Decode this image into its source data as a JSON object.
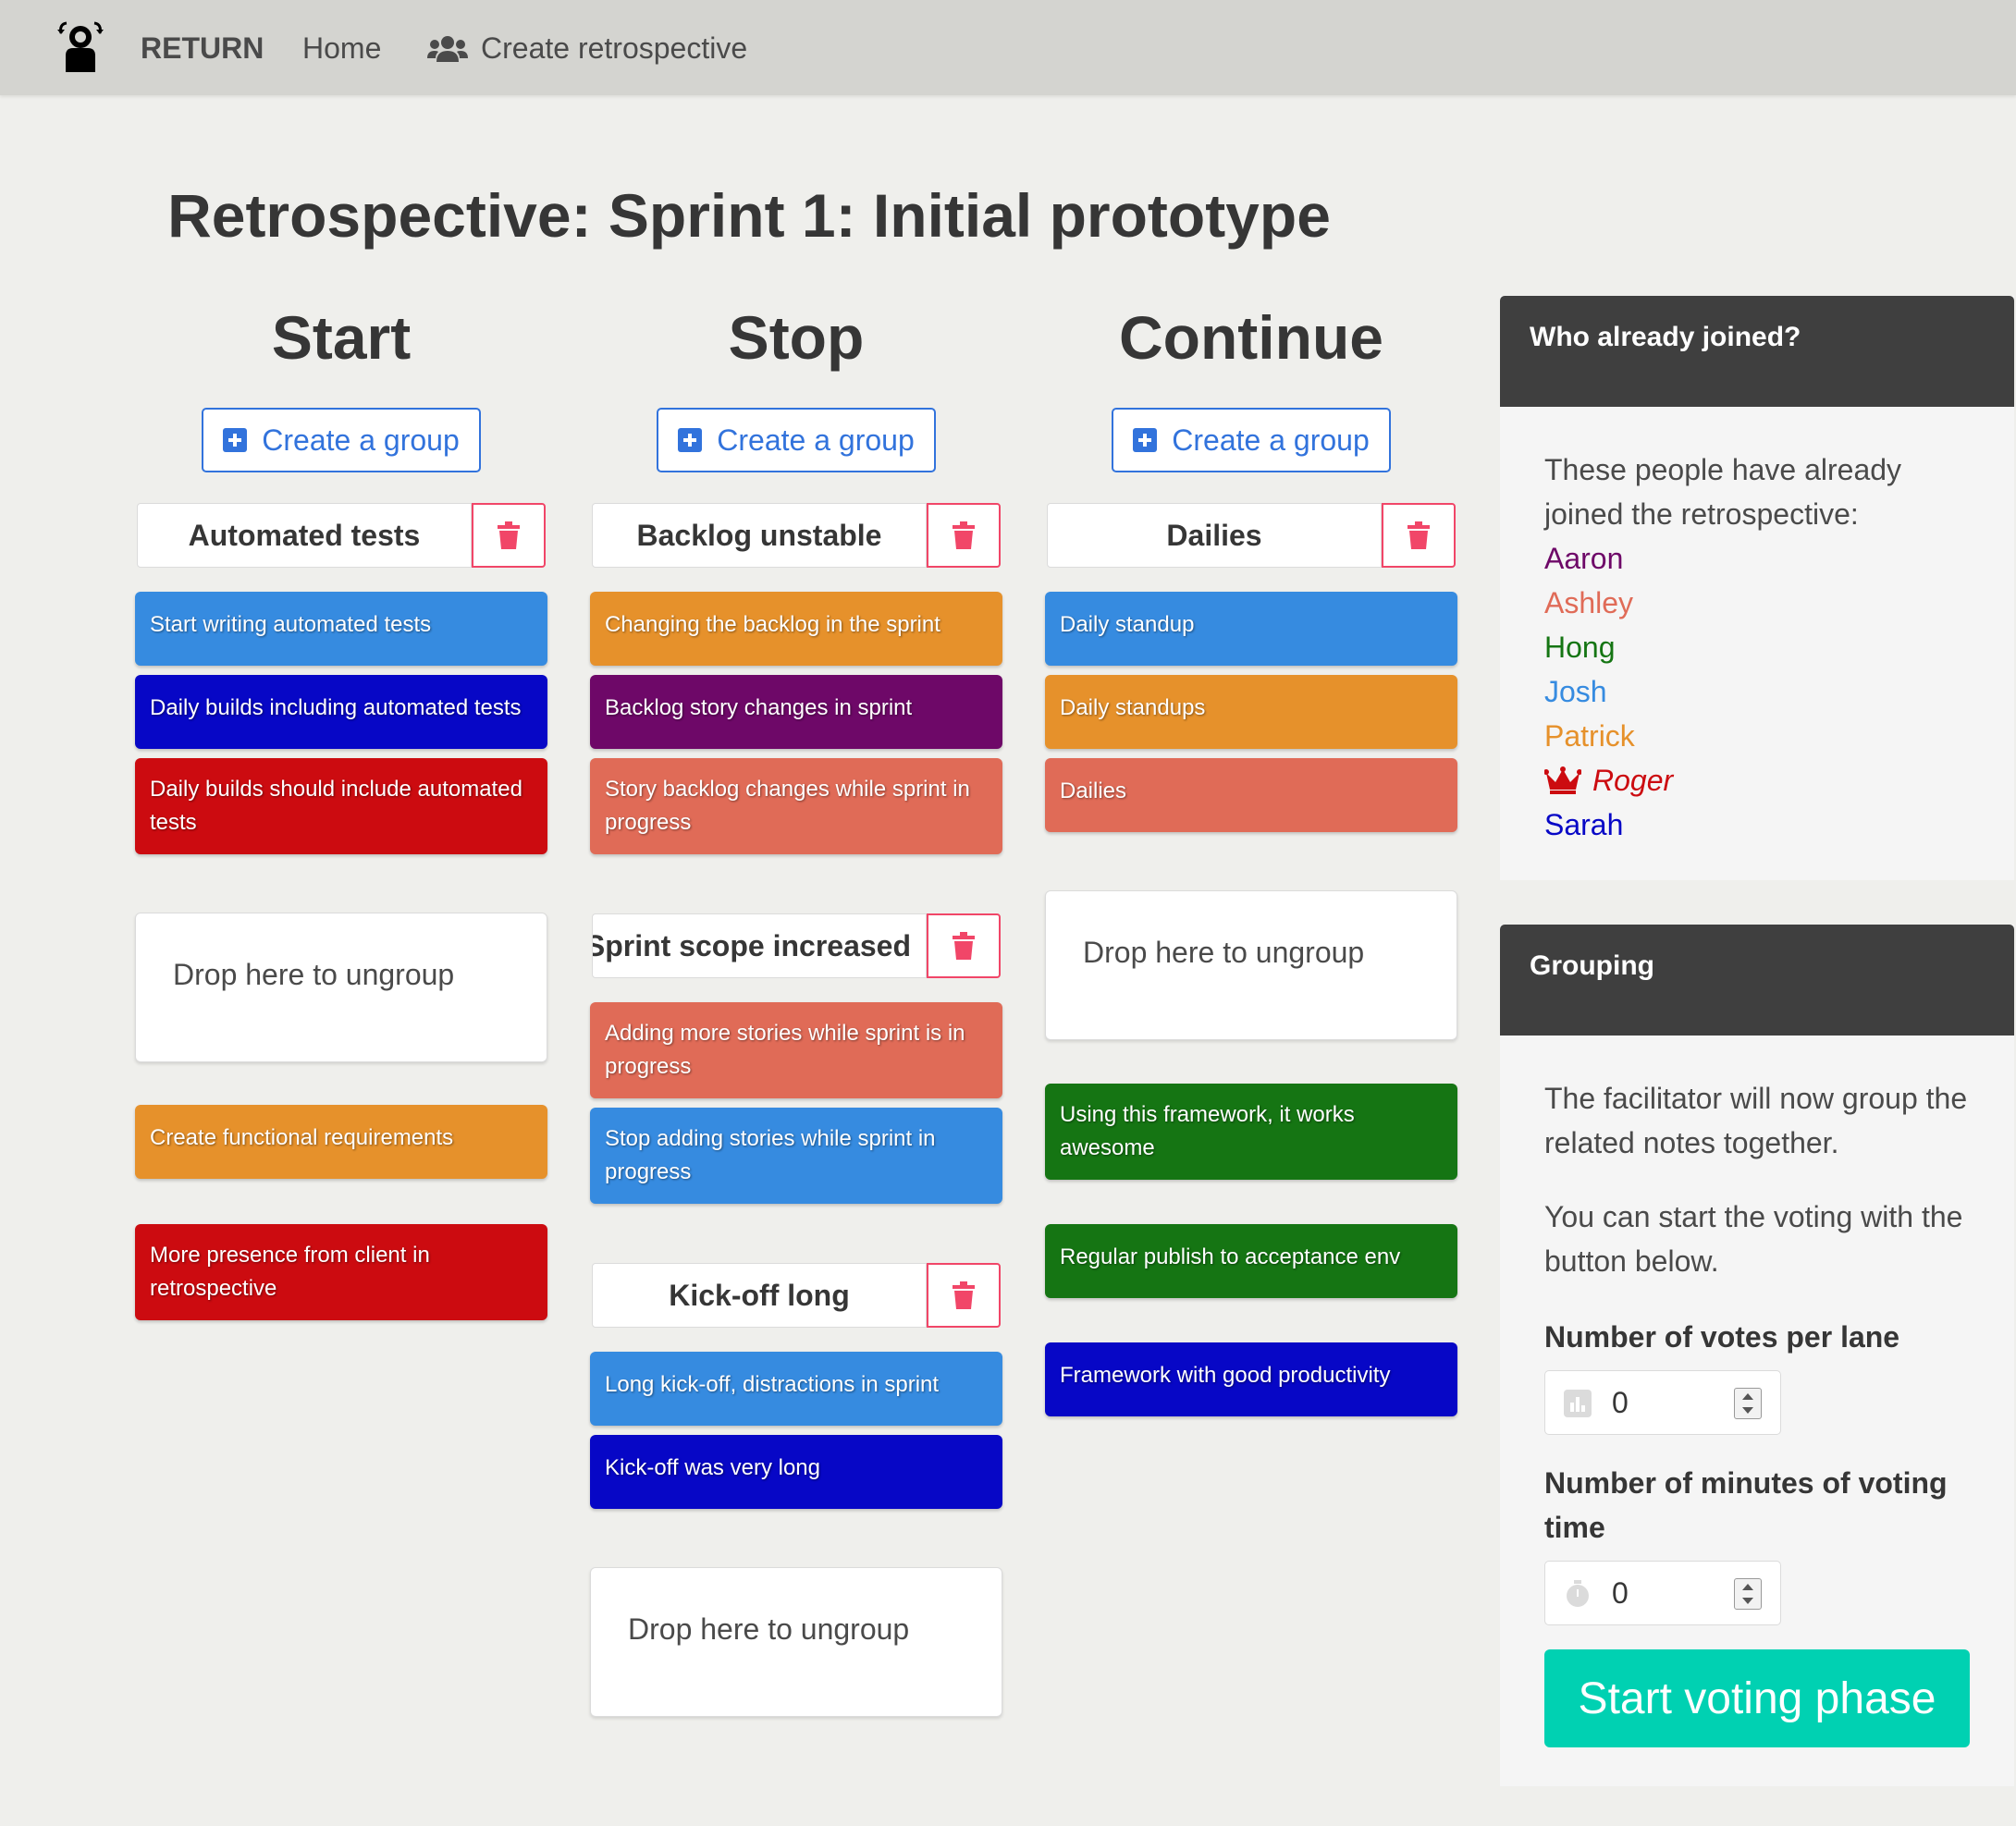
{
  "navbar": {
    "brand": "RETURN",
    "home": "Home",
    "create_retrospective": "Create retrospective"
  },
  "page": {
    "title": "Retrospective: Sprint 1: Initial prototype"
  },
  "colors": {
    "blue": "#368be0",
    "navy": "#0707c6",
    "red": "#cc0b10",
    "orange": "#e6912b",
    "purple": "#6e0868",
    "salmon": "#e06b57",
    "green": "#157513",
    "accent": "#3273dc",
    "danger": "#f14668",
    "primary": "#00d1b2"
  },
  "lanes": [
    {
      "title": "Start",
      "create_group_label": "Create a group",
      "groups": [
        {
          "title": "Automated tests",
          "notes": [
            {
              "text": "Start writing automated tests",
              "color": "#368be0"
            },
            {
              "text": "Daily builds including automated tests",
              "color": "#0707c6"
            },
            {
              "text": "Daily builds should include automated tests",
              "color": "#cc0b10"
            }
          ]
        }
      ],
      "dropzone_label": "Drop here to ungroup",
      "ungrouped": [
        {
          "text": "Create functional requirements",
          "color": "#e6912b"
        },
        {
          "text": "More presence from client in retrospective",
          "color": "#cc0b10"
        }
      ]
    },
    {
      "title": "Stop",
      "create_group_label": "Create a group",
      "groups": [
        {
          "title": "Backlog unstable",
          "notes": [
            {
              "text": "Changing the backlog in the sprint",
              "color": "#e6912b"
            },
            {
              "text": "Backlog story changes in sprint",
              "color": "#6e0868"
            },
            {
              "text": "Story backlog changes while sprint in progress",
              "color": "#e06b57"
            }
          ]
        },
        {
          "title": "Sprint scope increased",
          "notes": [
            {
              "text": "Adding more stories while sprint is in progress",
              "color": "#e06b57"
            },
            {
              "text": "Stop adding stories while sprint in progress",
              "color": "#368be0"
            }
          ]
        },
        {
          "title": "Kick-off long",
          "notes": [
            {
              "text": "Long kick-off, distractions in sprint",
              "color": "#368be0"
            },
            {
              "text": "Kick-off was very long",
              "color": "#0707c6"
            }
          ]
        }
      ],
      "dropzone_label": "Drop here to ungroup",
      "ungrouped": []
    },
    {
      "title": "Continue",
      "create_group_label": "Create a group",
      "groups": [
        {
          "title": "Dailies",
          "notes": [
            {
              "text": "Daily standup",
              "color": "#368be0"
            },
            {
              "text": "Daily standups",
              "color": "#e6912b"
            },
            {
              "text": "Dailies",
              "color": "#e06b57"
            }
          ]
        }
      ],
      "dropzone_label": "Drop here to ungroup",
      "ungrouped": [
        {
          "text": "Using this framework, it works awesome",
          "color": "#157513"
        },
        {
          "text": "Regular publish to acceptance env",
          "color": "#157513"
        },
        {
          "text": "Framework with good productivity",
          "color": "#0707c6"
        }
      ]
    }
  ],
  "joined_panel": {
    "heading": "Who already joined?",
    "intro": "These people have already joined the retrospective:",
    "participants": [
      {
        "name": "Aaron",
        "color": "#6e0868",
        "facilitator": false
      },
      {
        "name": "Ashley",
        "color": "#e06b57",
        "facilitator": false
      },
      {
        "name": "Hong",
        "color": "#157513",
        "facilitator": false
      },
      {
        "name": "Josh",
        "color": "#368be0",
        "facilitator": false
      },
      {
        "name": "Patrick",
        "color": "#e6912b",
        "facilitator": false
      },
      {
        "name": "Roger",
        "color": "#cc0b10",
        "facilitator": true
      },
      {
        "name": "Sarah",
        "color": "#0707c6",
        "facilitator": false
      }
    ]
  },
  "grouping_panel": {
    "heading": "Grouping",
    "text1": "The facilitator will now group the related notes together.",
    "text2": "You can start the voting with the button below.",
    "votes_label": "Number of votes per lane",
    "votes_value": "0",
    "minutes_label": "Number of minutes of voting time",
    "minutes_value": "0",
    "start_button": "Start voting phase"
  }
}
